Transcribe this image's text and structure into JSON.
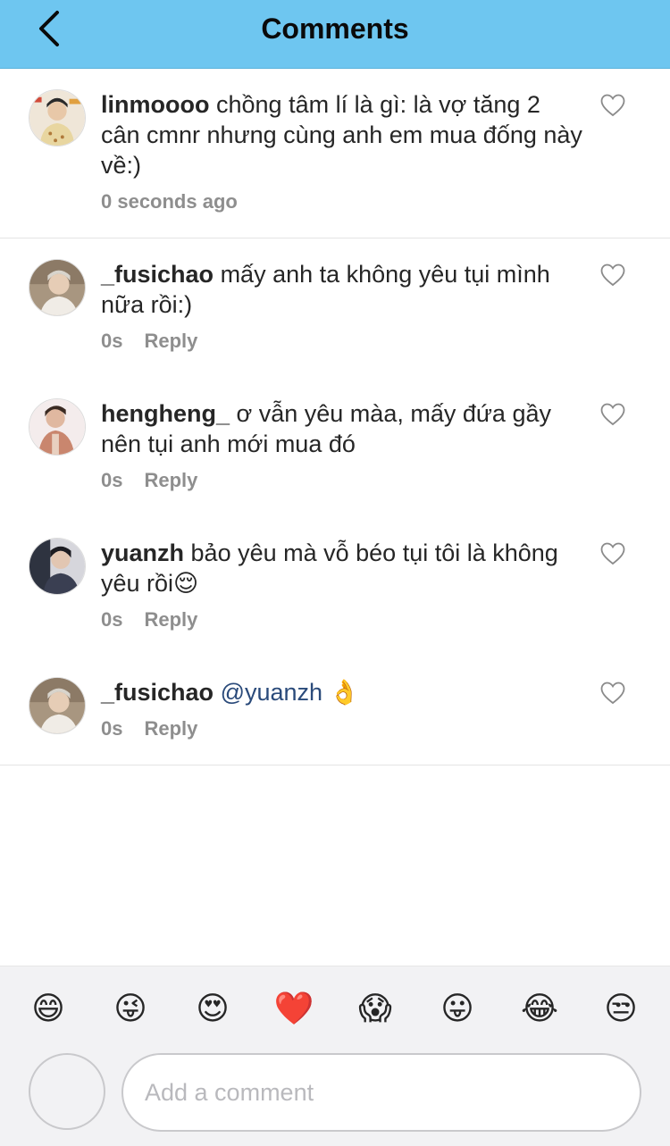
{
  "header": {
    "title": "Comments"
  },
  "comments": [
    {
      "username": "linmoooo",
      "text": "chồng tâm lí là gì: là vợ tăng 2 cân cmnr nhưng cùng anh em mua đống này về:)",
      "time": "0 seconds ago"
    },
    {
      "username": "_fusichao",
      "text": "mấy anh ta không yêu tụi mình nữa rồi:)",
      "time": "0s",
      "reply": "Reply"
    },
    {
      "username": "hengheng_",
      "text": "ơ vẫn yêu màa, mấy đứa gầy nên tụi anh mới mua đó",
      "time": "0s",
      "reply": "Reply"
    },
    {
      "username": "yuanzh",
      "text": "bảo yêu mà vỗ béo tụi tôi là không yêu rồi😌",
      "time": "0s",
      "reply": "Reply"
    },
    {
      "username": "_fusichao",
      "mention": "@yuanzh",
      "text": "👌",
      "time": "0s",
      "reply": "Reply"
    }
  ],
  "emojis": [
    "😄",
    "😜",
    "😍",
    "❤️",
    "😱",
    "😛",
    "😂",
    "😒"
  ],
  "input": {
    "placeholder": "Add a comment"
  },
  "colors": {
    "header_bg": "#6ec6f0",
    "mention": "#2a4a7a",
    "muted": "#8e8e8e"
  }
}
